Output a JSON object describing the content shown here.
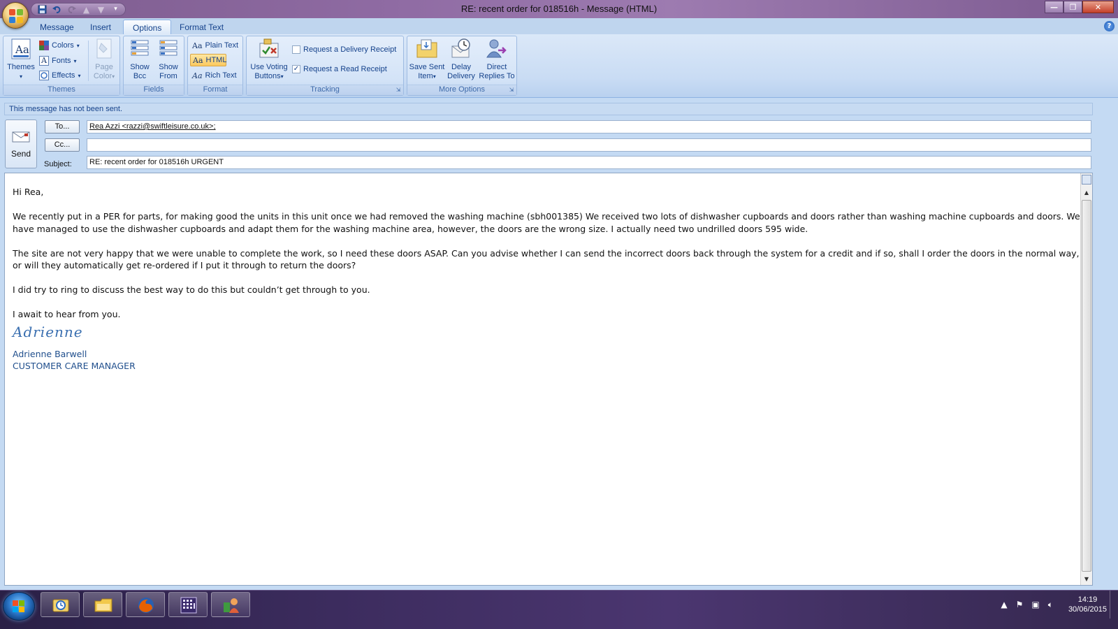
{
  "window": {
    "title": "RE: recent order for 018516h  - Message (HTML)"
  },
  "ribbon": {
    "tabs": [
      {
        "label": "Message",
        "active": false
      },
      {
        "label": "Insert",
        "active": false
      },
      {
        "label": "Options",
        "active": true
      },
      {
        "label": "Format Text",
        "active": false
      }
    ],
    "groups": {
      "themes": {
        "label": "Themes",
        "themes_label": "Themes",
        "colors_label": "Colors",
        "fonts_label": "Fonts",
        "effects_label": "Effects",
        "page_color_label_1": "Page",
        "page_color_label_2": "Color"
      },
      "fields": {
        "label": "Fields",
        "show_bcc_1": "Show",
        "show_bcc_2": "Bcc",
        "show_from_1": "Show",
        "show_from_2": "From"
      },
      "format": {
        "label": "Format",
        "plain_text": "Plain Text",
        "html": "HTML",
        "rich_text": "Rich Text",
        "selected": "HTML"
      },
      "tracking": {
        "label": "Tracking",
        "voting_1": "Use Voting",
        "voting_2": "Buttons",
        "delivery_receipt": "Request a Delivery Receipt",
        "delivery_receipt_checked": false,
        "read_receipt": "Request a Read Receipt",
        "read_receipt_checked": true
      },
      "more_options": {
        "label": "More Options",
        "save_sent_1": "Save Sent",
        "save_sent_2": "Item",
        "delay_1": "Delay",
        "delay_2": "Delivery",
        "direct_1": "Direct",
        "direct_2": "Replies To"
      }
    }
  },
  "compose": {
    "info_bar": "This message has not been sent.",
    "send_label": "Send",
    "to_button": "To...",
    "cc_button": "Cc...",
    "subject_label": "Subject:",
    "to_value": "Rea Azzi <razzi@swiftleisure.co.uk>",
    "to_suffix": ";",
    "cc_value": "",
    "subject_value": "RE: recent order for 018516h URGENT"
  },
  "message": {
    "greeting": "Hi Rea,",
    "paragraph_1": "We recently put in a PER for parts, for making good the units in this unit once we had removed the washing machine (sbh001385)  We received two lots of dishwasher cupboards and doors rather than washing machine cupboards and doors.  We have managed to use the dishwasher cupboards and adapt them for the washing machine area, however, the doors are the wrong size.  I actually need two undrilled doors 595 wide.",
    "paragraph_2": "The site are not very happy that we were unable to complete the work, so I need these doors ASAP.  Can you advise whether I can send the incorrect doors back through the system for a credit and if so, shall I order the doors in the normal way, or will they automatically get re-ordered if I put it through to return the doors?",
    "paragraph_3": "I did try to ring to discuss the best way to do this but couldn’t get through to you.",
    "paragraph_4": "I await to hear from you.",
    "signature_script": "Adrienne",
    "signature_name": "Adrienne Barwell",
    "signature_title": "CUSTOMER CARE MANAGER"
  },
  "taskbar": {
    "apps": [
      "outlook-icon",
      "file-explorer-icon",
      "firefox-icon",
      "calculator-grid-icon",
      "user-app-icon"
    ],
    "clock_time": "14:19",
    "clock_date": "30/06/2015"
  },
  "colors": {
    "ribbon_bg": "#c9dcf4",
    "title_bar": "#8f6ba3",
    "accent_text": "#15428b",
    "selected_format": "#fbc95f",
    "signature": "#1f4e8c"
  }
}
